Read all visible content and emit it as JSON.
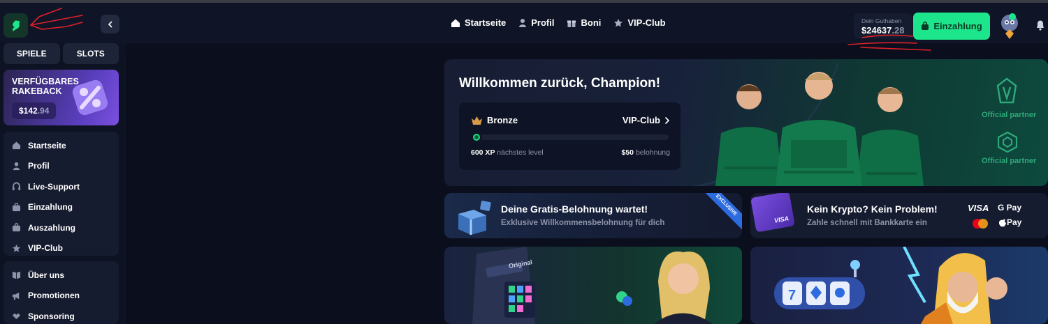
{
  "header": {
    "nav": [
      {
        "label": "Startseite",
        "icon": "home-icon"
      },
      {
        "label": "Profil",
        "icon": "user-icon"
      },
      {
        "label": "Boni",
        "icon": "gift-icon"
      },
      {
        "label": "VIP-Club",
        "icon": "star-icon"
      }
    ],
    "balance_label": "Dein Guthaben",
    "balance_int": "$24637",
    "balance_dec": ".28",
    "deposit_label": "Einzahlung"
  },
  "sidebar": {
    "tabs": [
      "SPIELE",
      "SLOTS"
    ],
    "rakeback_title": "VERFÜGBARES RAKEBACK",
    "rakeback_int": "$142",
    "rakeback_dec": ".94",
    "menu1": [
      {
        "label": "Startseite",
        "icon": "home-icon"
      },
      {
        "label": "Profil",
        "icon": "user-icon"
      },
      {
        "label": "Live-Support",
        "icon": "headset-icon"
      },
      {
        "label": "Einzahlung",
        "icon": "wallet-icon"
      },
      {
        "label": "Auszahlung",
        "icon": "wallet-out-icon"
      },
      {
        "label": "VIP-Club",
        "icon": "star-icon"
      }
    ],
    "menu2": [
      {
        "label": "Über uns",
        "icon": "book-icon"
      },
      {
        "label": "Promotionen",
        "icon": "megaphone-icon"
      },
      {
        "label": "Sponsoring",
        "icon": "handshake-icon"
      }
    ]
  },
  "hero": {
    "title": "Willkommen zurück, Champion!",
    "rank": "Bronze",
    "vip_link": "VIP-Club",
    "progress": 0.03,
    "xp": "600 XP",
    "xp_suffix": "nächstes level",
    "reward": "$50",
    "reward_suffix": "belohnung",
    "partners": [
      "Official partner",
      "Official partner"
    ]
  },
  "promos": [
    {
      "title": "Deine Gratis-Belohnung wartet!",
      "subtitle": "Exklusive Willkommensbelohnung für dich",
      "badge": "EXCLUSIVE"
    },
    {
      "title": "Kein Krypto? Kein Problem!",
      "subtitle": "Zahle schnell mit Bankkarte ein",
      "card_label": "VISA",
      "pay": [
        "VISA",
        "G Pay",
        "Pay"
      ]
    }
  ],
  "games": {
    "original_label": "Original"
  },
  "colors": {
    "accent": "#1de58c",
    "background": "#0e1324",
    "panel": "#161c2f",
    "annotation": "#e0202a"
  }
}
